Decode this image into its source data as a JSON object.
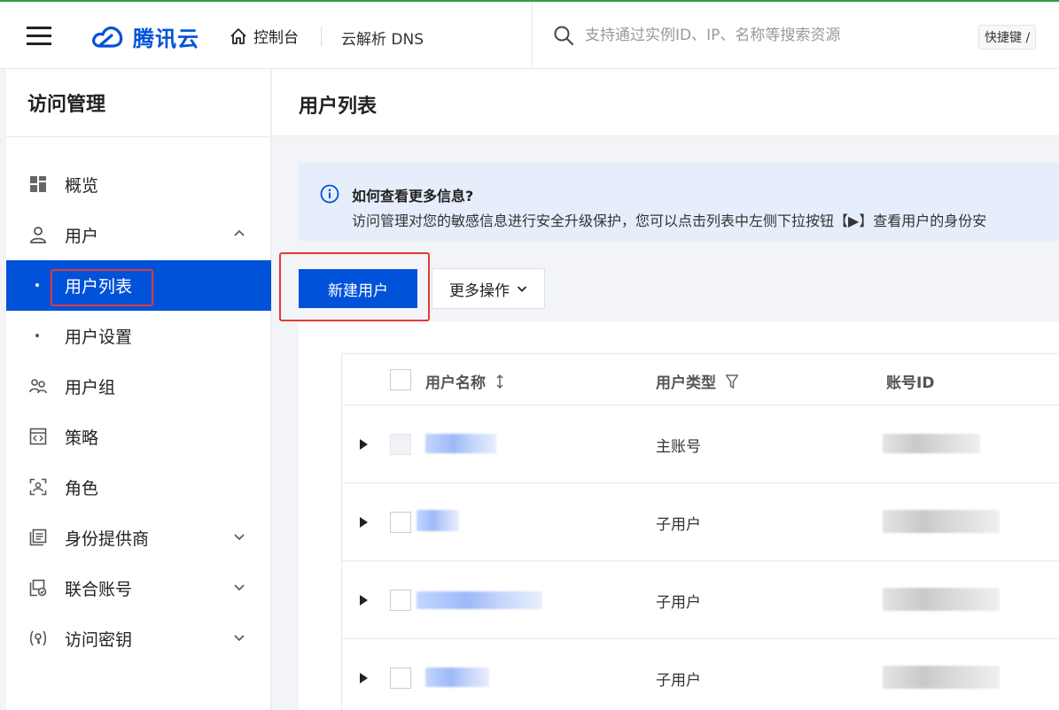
{
  "topbar": {
    "brand": "腾讯云",
    "console_label": "控制台",
    "product_label": "云解析 DNS",
    "search_placeholder": "支持通过实例ID、IP、名称等搜索资源",
    "shortcut_label": "快捷键 /"
  },
  "sidebar": {
    "title": "访问管理",
    "items": [
      {
        "label": "概览",
        "icon": "dashboard-icon"
      },
      {
        "label": "用户",
        "icon": "user-icon",
        "expanded": true
      },
      {
        "label": "用户列表",
        "sub": true,
        "active": true
      },
      {
        "label": "用户设置",
        "sub": true
      },
      {
        "label": "用户组",
        "icon": "user-group-icon"
      },
      {
        "label": "策略",
        "icon": "policy-icon"
      },
      {
        "label": "角色",
        "icon": "role-icon"
      },
      {
        "label": "身份提供商",
        "icon": "identity-provider-icon",
        "expandable": true
      },
      {
        "label": "联合账号",
        "icon": "federated-account-icon",
        "expandable": true
      },
      {
        "label": "访问密钥",
        "icon": "access-key-icon",
        "expandable": true
      }
    ]
  },
  "main": {
    "title": "用户列表",
    "banner": {
      "title": "如何查看更多信息?",
      "description": "访问管理对您的敏感信息进行安全升级保护，您可以点击列表中左侧下拉按钮【▶】查看用户的身份安"
    },
    "toolbar": {
      "create_label": "新建用户",
      "more_label": "更多操作"
    },
    "table": {
      "columns": [
        "用户名称",
        "用户类型",
        "账号ID"
      ],
      "rows": [
        {
          "type": "主账号"
        },
        {
          "type": "子用户"
        },
        {
          "type": "子用户"
        },
        {
          "type": "子用户"
        }
      ]
    }
  },
  "colors": {
    "accent": "#0052d9",
    "highlight_box": "#e53935"
  }
}
